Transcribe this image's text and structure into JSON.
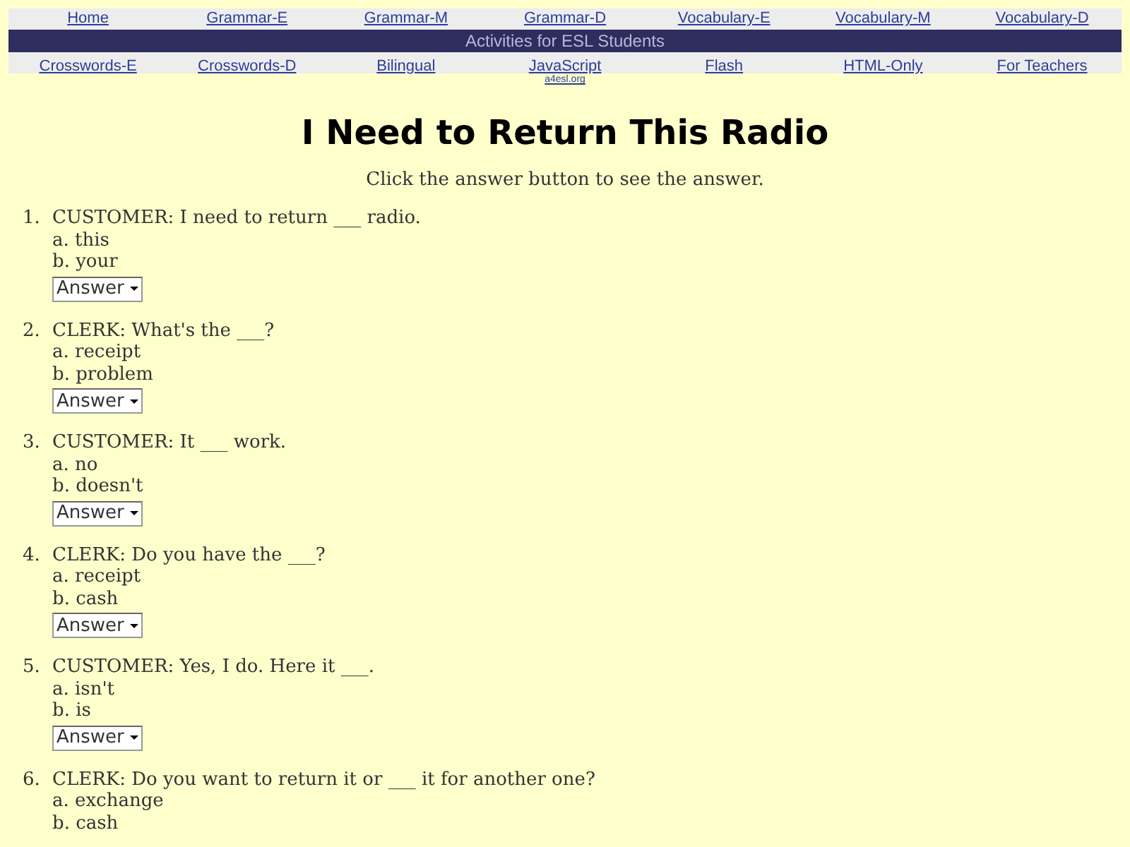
{
  "nav_top": [
    "Home",
    "Grammar-E",
    "Grammar-M",
    "Grammar-D",
    "Vocabulary-E",
    "Vocabulary-M",
    "Vocabulary-D"
  ],
  "banner": "Activities for ESL Students",
  "nav_bottom": [
    "Crosswords-E",
    "Crosswords-D",
    "Bilingual",
    "JavaScript",
    "Flash",
    "HTML-Only",
    "For Teachers"
  ],
  "site_link": "a4esl.org",
  "title": "I Need to Return This Radio",
  "instructions": "Click the answer button to see the answer.",
  "questions": [
    {
      "number": "1.",
      "text": "CUSTOMER: I need to return ___ radio.",
      "options": [
        "a. this",
        "b. your"
      ],
      "answer_button": "Answer"
    },
    {
      "number": "2.",
      "text": "CLERK: What's the ___?",
      "options": [
        "a. receipt",
        "b. problem"
      ],
      "answer_button": "Answer"
    },
    {
      "number": "3.",
      "text": "CUSTOMER: It ___ work.",
      "options": [
        "a. no",
        "b. doesn't"
      ],
      "answer_button": "Answer"
    },
    {
      "number": "4.",
      "text": "CLERK: Do you have the ___?",
      "options": [
        "a. receipt",
        "b. cash"
      ],
      "answer_button": "Answer"
    },
    {
      "number": "5.",
      "text": "CUSTOMER: Yes, I do. Here it ___.",
      "options": [
        "a. isn't",
        "b. is"
      ],
      "answer_button": "Answer"
    },
    {
      "number": "6.",
      "text": "CLERK: Do you want to return it or ___ it for another one?",
      "options": [
        "a. exchange",
        "b. cash"
      ]
    }
  ]
}
